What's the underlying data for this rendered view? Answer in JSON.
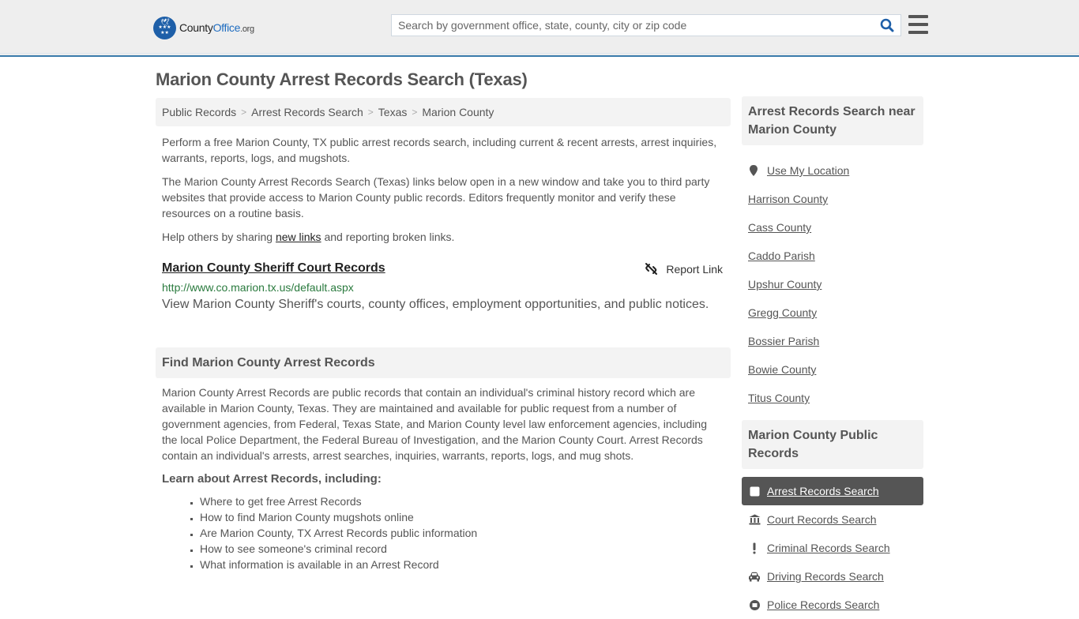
{
  "header": {
    "logo_main": "County",
    "logo_accent": "Office",
    "logo_suffix": ".org",
    "search_placeholder": "Search by government office, state, county, city or zip code",
    "search_value": "",
    "search_icon": "search-icon",
    "menu_icon": "hamburger-menu-icon",
    "accent_color": "#1e5fa8",
    "border_color": "#3a7bab"
  },
  "page": {
    "title": "Marion County Arrest Records Search (Texas)"
  },
  "breadcrumb": [
    {
      "label": "Public Records"
    },
    {
      "label": "Arrest Records Search"
    },
    {
      "label": "Texas"
    },
    {
      "label": "Marion County"
    }
  ],
  "breadcrumb_separator": ">",
  "intro": {
    "p1": "Perform a free Marion County, TX public arrest records search, including current & recent arrests, arrest inquiries, warrants, reports, logs, and mugshots.",
    "p2": "The Marion County Arrest Records Search (Texas) links below open in a new window and take you to third party websites that provide access to Marion County public records. Editors frequently monitor and verify these resources on a routine basis.",
    "p3_before": "Help others by sharing ",
    "p3_link": "new links",
    "p3_after": " and reporting broken links."
  },
  "resources": [
    {
      "title": "Marion County Sheriff Court Records",
      "url": "http://www.co.marion.tx.us/default.aspx",
      "description": "View Marion County Sheriff's courts, county offices, employment opportunities, and public notices.",
      "report_label": "Report Link",
      "url_color": "#2a7a3e"
    }
  ],
  "find_section": {
    "heading": "Find Marion County Arrest Records",
    "body": "Marion County Arrest Records are public records that contain an individual's criminal history record which are available in Marion County, Texas. They are maintained and available for public request from a number of government agencies, from Federal, Texas State, and Marion County level law enforcement agencies, including the local Police Department, the Federal Bureau of Investigation, and the Marion County Court. Arrest Records contain an individual's arrests, arrest searches, inquiries, warrants, reports, logs, and mug shots.",
    "learn_heading": "Learn about Arrest Records, including:",
    "learn_items": [
      "Where to get free Arrest Records",
      "How to find Marion County mugshots online",
      "Are Marion County, TX Arrest Records public information",
      "How to see someone's criminal record",
      "What information is available in an Arrest Record"
    ]
  },
  "sidebar": {
    "near_heading": "Arrest Records Search near Marion County",
    "use_location": "Use My Location",
    "near_items": [
      "Harrison County",
      "Cass County",
      "Caddo Parish",
      "Upshur County",
      "Gregg County",
      "Bossier Parish",
      "Bowie County",
      "Titus County"
    ],
    "records_heading": "Marion County Public Records",
    "records_items": [
      {
        "label": "Arrest Records Search",
        "icon": "square-icon",
        "active": true
      },
      {
        "label": "Court Records Search",
        "icon": "courthouse-icon",
        "active": false
      },
      {
        "label": "Criminal Records Search",
        "icon": "exclamation-icon",
        "active": false
      },
      {
        "label": "Driving Records Search",
        "icon": "car-icon",
        "active": false
      },
      {
        "label": "Police Records Search",
        "icon": "police-icon",
        "active": false
      }
    ]
  }
}
